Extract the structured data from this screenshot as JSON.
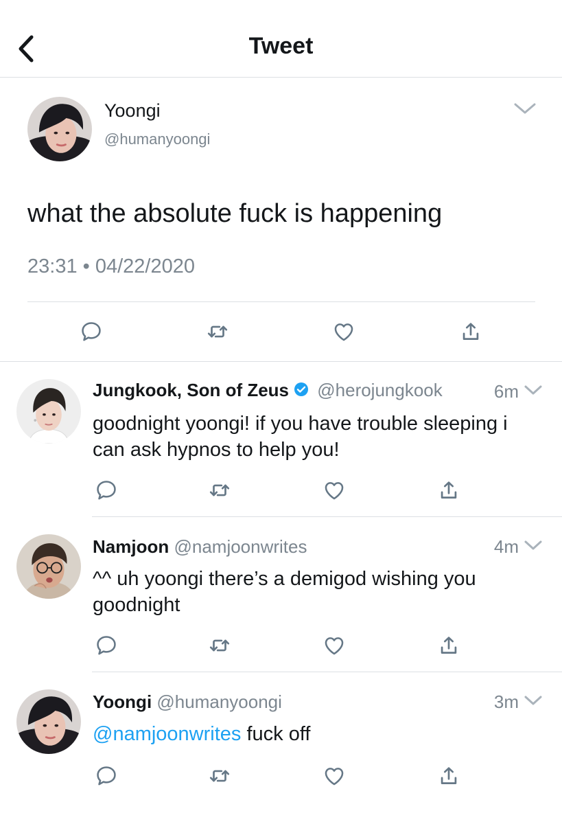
{
  "header": {
    "title": "Tweet",
    "back_icon": "chevron-left-icon"
  },
  "main_tweet": {
    "author_name": "Yoongi",
    "author_handle": "@humanyoongi",
    "text": "what the absolute fuck is happening",
    "timestamp": "23:31 • 04/22/2020",
    "actions": [
      "reply-icon",
      "retweet-icon",
      "like-icon",
      "share-icon"
    ]
  },
  "replies": [
    {
      "author_name": "Jungkook, Son of Zeus",
      "verified": true,
      "author_handle": "@herojungkook",
      "time": "6m",
      "text": "goodnight yoongi! if you have trouble sleeping i can ask hypnos to help you!"
    },
    {
      "author_name": "Namjoon",
      "verified": false,
      "author_handle": "@namjoonwrites",
      "time": "4m",
      "text": "^^ uh yoongi there’s a demigod wishing you goodnight"
    },
    {
      "author_name": "Yoongi",
      "verified": false,
      "author_handle": "@humanyoongi",
      "time": "3m",
      "mention": "@namjoonwrites",
      "text": " fuck off"
    }
  ],
  "colors": {
    "accent": "#1da1f2",
    "secondary_text": "#7c868f",
    "divider": "#dcdfe3",
    "icon": "#657786"
  }
}
